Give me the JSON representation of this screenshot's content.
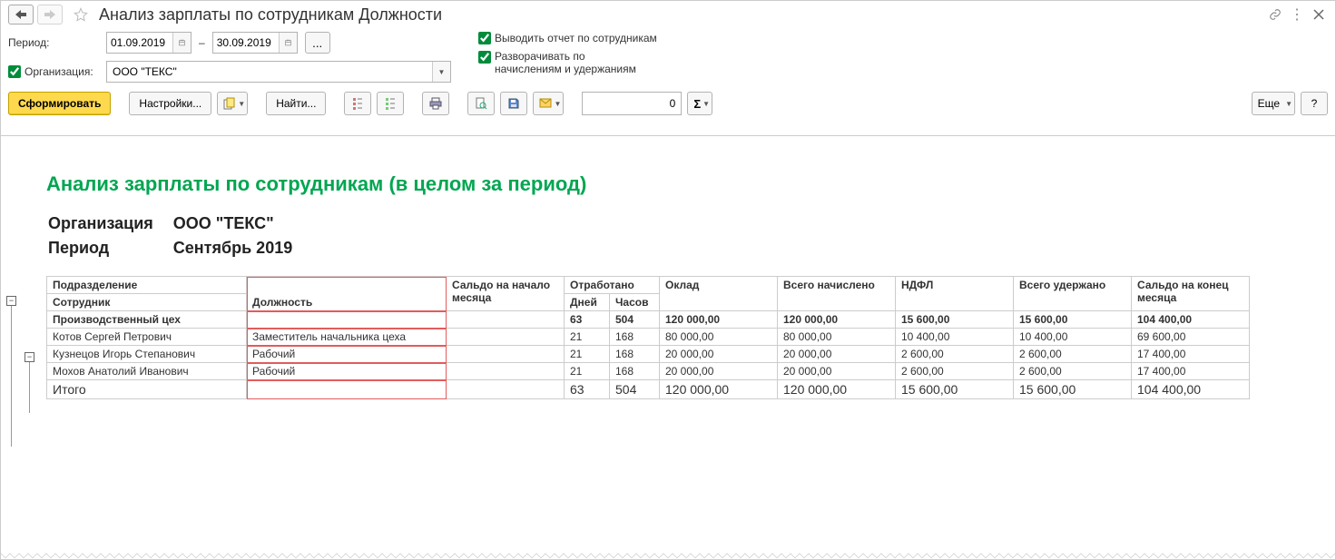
{
  "title": "Анализ зарплаты по сотрудникам Должности",
  "period_label": "Период:",
  "date_from": "01.09.2019",
  "date_to": "30.09.2019",
  "date_sep": "–",
  "org_checkbox_label": "Организация:",
  "org_value": "ООО \"ТЕКС\"",
  "check_by_employees": "Выводить отчет по сотрудникам",
  "check_expand": "Разворачивать по\nначислениям и удержаниям",
  "toolbar": {
    "generate": "Сформировать",
    "settings": "Настройки...",
    "find": "Найти...",
    "more": "Еще",
    "help": "?",
    "num_value": "0"
  },
  "report": {
    "title": "Анализ зарплаты по сотрудникам (в целом за период)",
    "meta_org_label": "Организация",
    "meta_org_value": "ООО \"ТЕКС\"",
    "meta_period_label": "Период",
    "meta_period_value": "Сентябрь 2019",
    "columns": {
      "subdivision": "Подразделение",
      "employee": "Сотрудник",
      "position": "Должность",
      "saldo_start": "Сальдо на начало месяца",
      "worked": "Отработано",
      "days": "Дней",
      "hours": "Часов",
      "salary": "Оклад",
      "accrued": "Всего начислено",
      "ndfl": "НДФЛ",
      "withheld": "Всего удержано",
      "saldo_end": "Сальдо на конец месяца"
    },
    "group": {
      "name": "Производственный цех",
      "days": "63",
      "hours": "504",
      "salary": "120 000,00",
      "accrued": "120 000,00",
      "ndfl": "15 600,00",
      "withheld": "15 600,00",
      "saldo_end": "104 400,00"
    },
    "rows": [
      {
        "name": "Котов Сергей Петрович",
        "position": "Заместитель начальника цеха",
        "days": "21",
        "hours": "168",
        "salary": "80 000,00",
        "accrued": "80 000,00",
        "ndfl": "10 400,00",
        "withheld": "10 400,00",
        "saldo_end": "69 600,00"
      },
      {
        "name": "Кузнецов Игорь Степанович",
        "position": "Рабочий",
        "days": "21",
        "hours": "168",
        "salary": "20 000,00",
        "accrued": "20 000,00",
        "ndfl": "2 600,00",
        "withheld": "2 600,00",
        "saldo_end": "17 400,00"
      },
      {
        "name": "Мохов Анатолий Иванович",
        "position": "Рабочий",
        "days": "21",
        "hours": "168",
        "salary": "20 000,00",
        "accrued": "20 000,00",
        "ndfl": "2 600,00",
        "withheld": "2 600,00",
        "saldo_end": "17 400,00"
      }
    ],
    "total": {
      "label": "Итого",
      "days": "63",
      "hours": "504",
      "salary": "120 000,00",
      "accrued": "120 000,00",
      "ndfl": "15 600,00",
      "withheld": "15 600,00",
      "saldo_end": "104 400,00"
    }
  }
}
